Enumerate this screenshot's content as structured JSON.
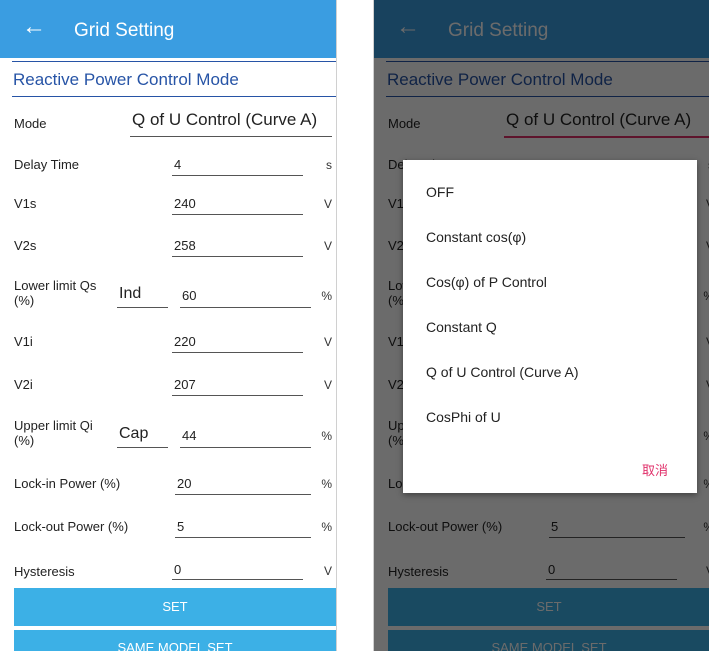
{
  "header": {
    "back_glyph": "←",
    "title": "Grid Setting"
  },
  "section": {
    "title": "Reactive Power Control Mode"
  },
  "mode": {
    "label": "Mode",
    "value": "Q of U Control (Curve A)"
  },
  "fields": [
    {
      "label": "Delay Time",
      "value": "4",
      "unit": "s"
    },
    {
      "label": "V1s",
      "value": "240",
      "unit": "V"
    },
    {
      "label": "V2s",
      "value": "258",
      "unit": "V"
    },
    {
      "label": "Lower limit Qs (%)",
      "prefix": "Ind",
      "value": "60",
      "unit": "%"
    },
    {
      "label": "V1i",
      "value": "220",
      "unit": "V"
    },
    {
      "label": "V2i",
      "value": "207",
      "unit": "V"
    },
    {
      "label": "Upper limit Qi (%)",
      "prefix": "Cap",
      "value": "44",
      "unit": "%"
    },
    {
      "label": "Lock-in Power (%)",
      "value": "20",
      "unit": "%"
    },
    {
      "label": "Lock-out Power (%)",
      "value": "5",
      "unit": "%"
    },
    {
      "label": "Hysteresis",
      "value": "0",
      "unit": "V"
    }
  ],
  "buttons": {
    "set": "SET",
    "same_model_set": "SAME MODEL SET"
  },
  "dialog": {
    "options": [
      "OFF",
      "Constant cos(φ)",
      "Cos(φ) of P Control",
      "Constant Q",
      "Q of U Control (Curve A)",
      "CosPhi of U"
    ],
    "cancel": "取消"
  },
  "colors": {
    "appbar": "#3a9de1",
    "section_title": "#2754a6",
    "button": "#3cb0e6",
    "cancel": "#e0306a"
  }
}
